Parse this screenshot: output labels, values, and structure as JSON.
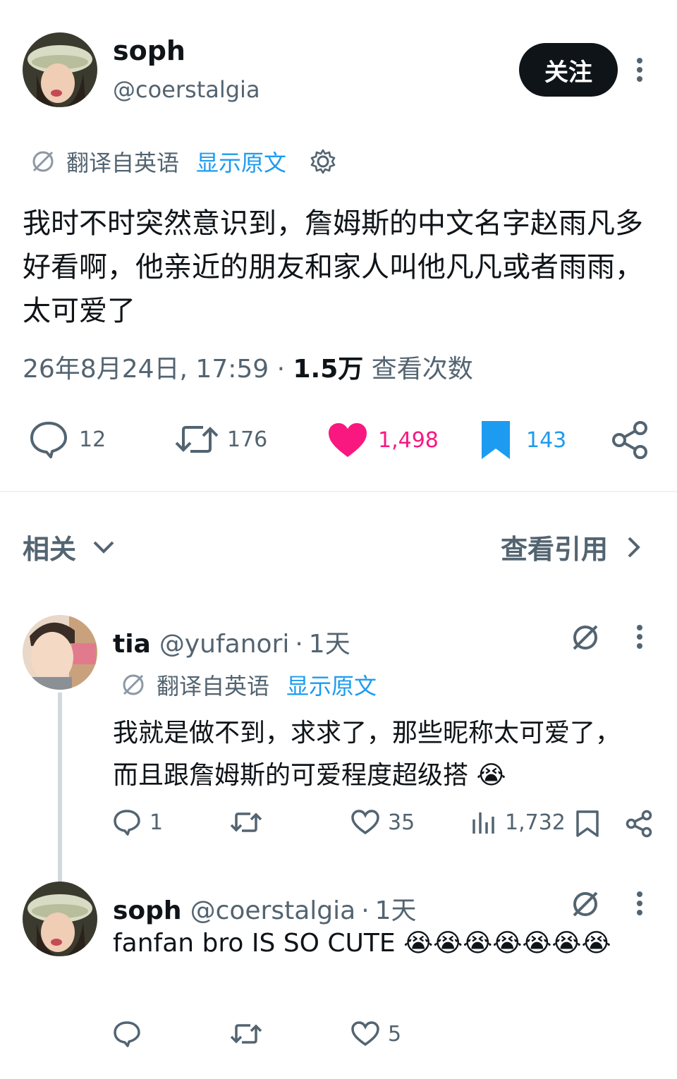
{
  "main_tweet": {
    "display_name": "soph",
    "handle": "@coerstalgia",
    "follow_label": "关注",
    "translated_label": "翻译自英语",
    "show_original_label": "显示原文",
    "text": "我时不时突然意识到，詹姆斯的中文名字赵雨凡多好看啊，他亲近的朋友和家人叫他凡凡或者雨雨，太可爱了",
    "timestamp": "26年8月24日, 17:59",
    "views_count": "1.5万",
    "views_label": "查看次数",
    "replies": "12",
    "retweets": "176",
    "likes": "1,498",
    "bookmarks": "143"
  },
  "related": {
    "title": "相关",
    "view_quotes": "查看引用"
  },
  "replies": [
    {
      "display_name": "tia",
      "handle": "@yufanori",
      "separator": "·",
      "age": "1天",
      "translated_label": "翻译自英语",
      "show_original_label": "显示原文",
      "text": "我就是做不到，求求了，那些昵称太可爱了，而且跟詹姆斯的可爱程度超级搭",
      "emoji": "😭",
      "reply_count": "1",
      "retweet_count": "",
      "like_count": "35",
      "view_count": "1,732"
    },
    {
      "display_name": "soph",
      "handle": "@coerstalgia",
      "separator": "·",
      "age": "1天",
      "text": "fanfan bro IS SO CUTE",
      "emoji": "😭😭😭😭😭😭😭",
      "reply_count": "",
      "retweet_count": "",
      "like_count": "5"
    }
  ],
  "colors": {
    "like_pink": "#f91880",
    "bookmark_blue": "#1d9bf0",
    "link_blue": "#1d9bf0",
    "muted_gray": "#536471"
  }
}
